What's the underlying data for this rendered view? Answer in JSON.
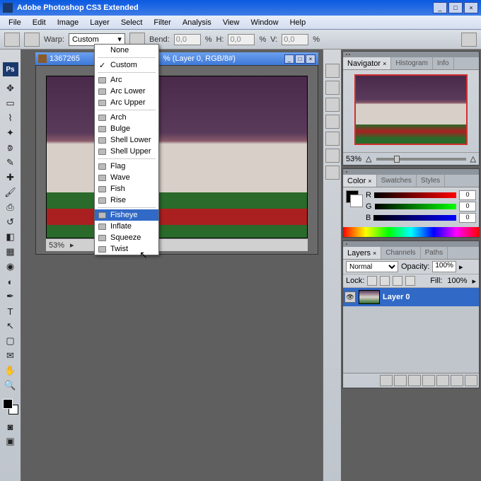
{
  "app": {
    "title": "Adobe Photoshop CS3 Extended"
  },
  "menu": {
    "items": [
      "File",
      "Edit",
      "Image",
      "Layer",
      "Select",
      "Filter",
      "Analysis",
      "View",
      "Window",
      "Help"
    ]
  },
  "options": {
    "warp_label": "Warp:",
    "warp_value": "Custom",
    "bend_label": "Bend:",
    "bend_value": "0,0",
    "h_label": "H:",
    "h_value": "0,0",
    "v_label": "V:",
    "v_value": "0,0",
    "pct": "%"
  },
  "warp_dropdown": {
    "none": "None",
    "custom": "Custom",
    "group1": [
      "Arc",
      "Arc Lower",
      "Arc Upper"
    ],
    "group2": [
      "Arch",
      "Bulge",
      "Shell Lower",
      "Shell Upper"
    ],
    "group3": [
      "Flag",
      "Wave",
      "Fish",
      "Rise"
    ],
    "group4": [
      "Fisheye",
      "Inflate",
      "Squeeze",
      "Twist"
    ]
  },
  "document": {
    "title_pre": "1367265",
    "title_suf": "% (Layer 0, RGB/8#)",
    "zoom": "53%",
    "status_info": ""
  },
  "navigator": {
    "tabs": [
      "Navigator",
      "Histogram",
      "Info"
    ],
    "zoom": "53%"
  },
  "color": {
    "tabs": [
      "Color",
      "Swatches",
      "Styles"
    ],
    "r_label": "R",
    "r_val": "0",
    "g_label": "G",
    "g_val": "0",
    "b_label": "B",
    "b_val": "0"
  },
  "layers": {
    "tabs": [
      "Layers",
      "Channels",
      "Paths"
    ],
    "blend": "Normal",
    "opacity_label": "Opacity:",
    "opacity": "100%",
    "lock_label": "Lock:",
    "fill_label": "Fill:",
    "fill": "100%",
    "layer0": "Layer 0"
  }
}
